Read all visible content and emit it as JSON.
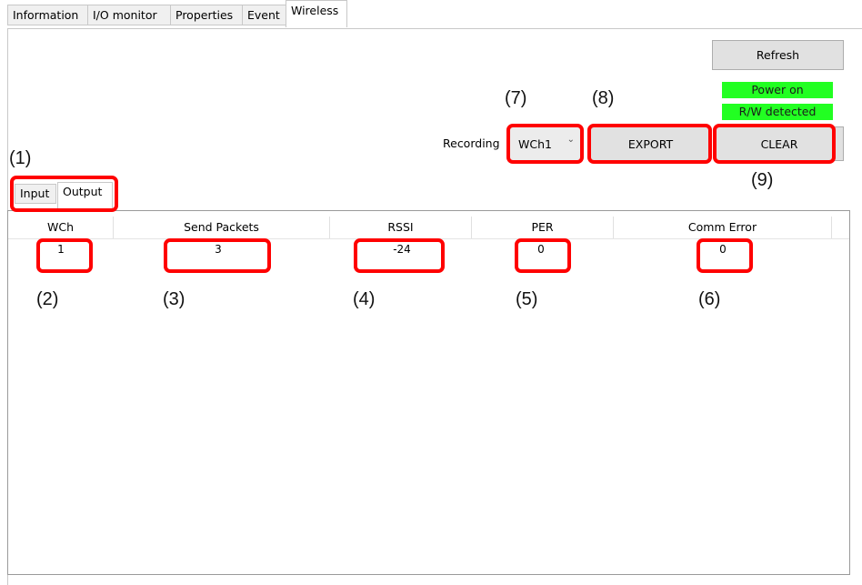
{
  "tabs": [
    "Information",
    "I/O monitor",
    "Properties",
    "Event",
    "Wireless"
  ],
  "active_tab": "Wireless",
  "toolbar": {
    "refresh_label": "Refresh",
    "status_power": "Power on",
    "status_rw": "R/W detected",
    "recording_label": "Recording",
    "recording_value": "WCh1",
    "export_label": "EXPORT",
    "clear_label": "CLEAR"
  },
  "inner_tabs": [
    "Input",
    "Output"
  ],
  "table": {
    "columns": [
      "WCh",
      "Send Packets",
      "RSSI",
      "PER",
      "Comm Error"
    ],
    "rows": [
      [
        "1",
        "3",
        "-24",
        "0",
        "0"
      ]
    ]
  },
  "callouts": [
    "(1)",
    "(2)",
    "(3)",
    "(4)",
    "(5)",
    "(6)",
    "(7)",
    "(8)",
    "(9)"
  ],
  "colors": {
    "status_green": "#22ff22",
    "highlight_red": "#ff0000"
  },
  "icons": {
    "combo_arrow": "chevron-down-icon"
  }
}
